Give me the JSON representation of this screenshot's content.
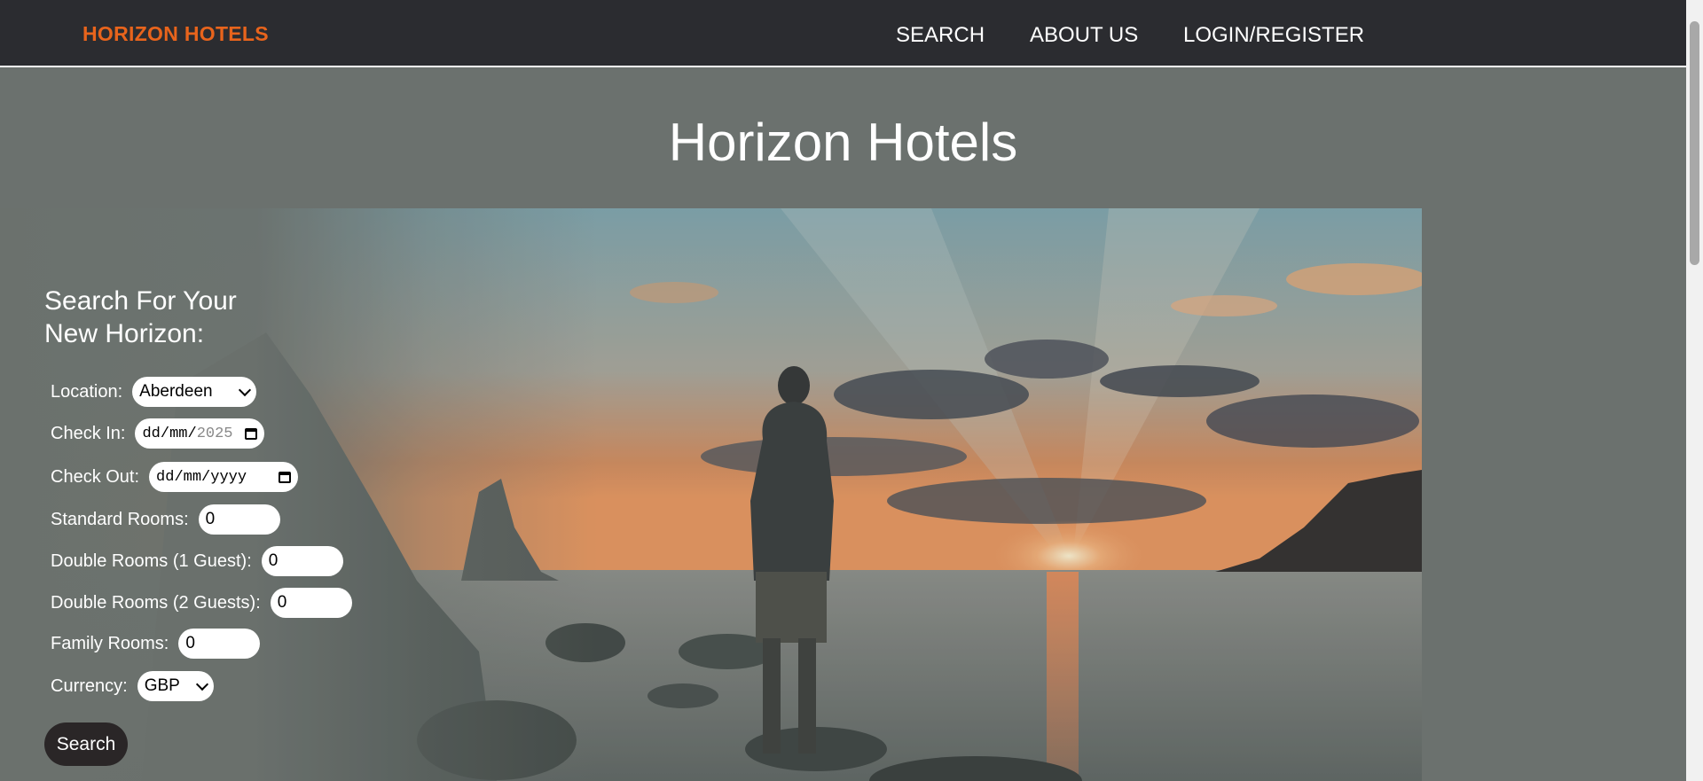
{
  "nav": {
    "brand": "HORIZON HOTELS",
    "links": [
      "SEARCH",
      "ABOUT US",
      "LOGIN/REGISTER"
    ]
  },
  "page": {
    "title": "Horizon Hotels"
  },
  "search": {
    "heading": "Search For Your New Horizon:",
    "location_label": "Location:",
    "location_value": "Aberdeen",
    "checkin_label": "Check In:",
    "checkin_placeholder": "dd/mm/",
    "checkin_year": "2025",
    "checkout_label": "Check Out:",
    "checkout_placeholder": "dd/mm/yyyy",
    "standard_label": "Standard Rooms:",
    "standard_value": "0",
    "double1_label": "Double Rooms (1 Guest):",
    "double1_value": "0",
    "double2_label": "Double Rooms (2 Guests):",
    "double2_value": "0",
    "family_label": "Family Rooms:",
    "family_value": "0",
    "currency_label": "Currency:",
    "currency_value": "GBP",
    "button_label": "Search"
  },
  "icons": {
    "select_chevron": "chevron-down-icon",
    "date_picker": "calendar-icon"
  },
  "colors": {
    "brand": "#e8641c",
    "navbar": "#2b2c30",
    "page_bg": "#6b716e",
    "button_bg": "#2a2627"
  }
}
